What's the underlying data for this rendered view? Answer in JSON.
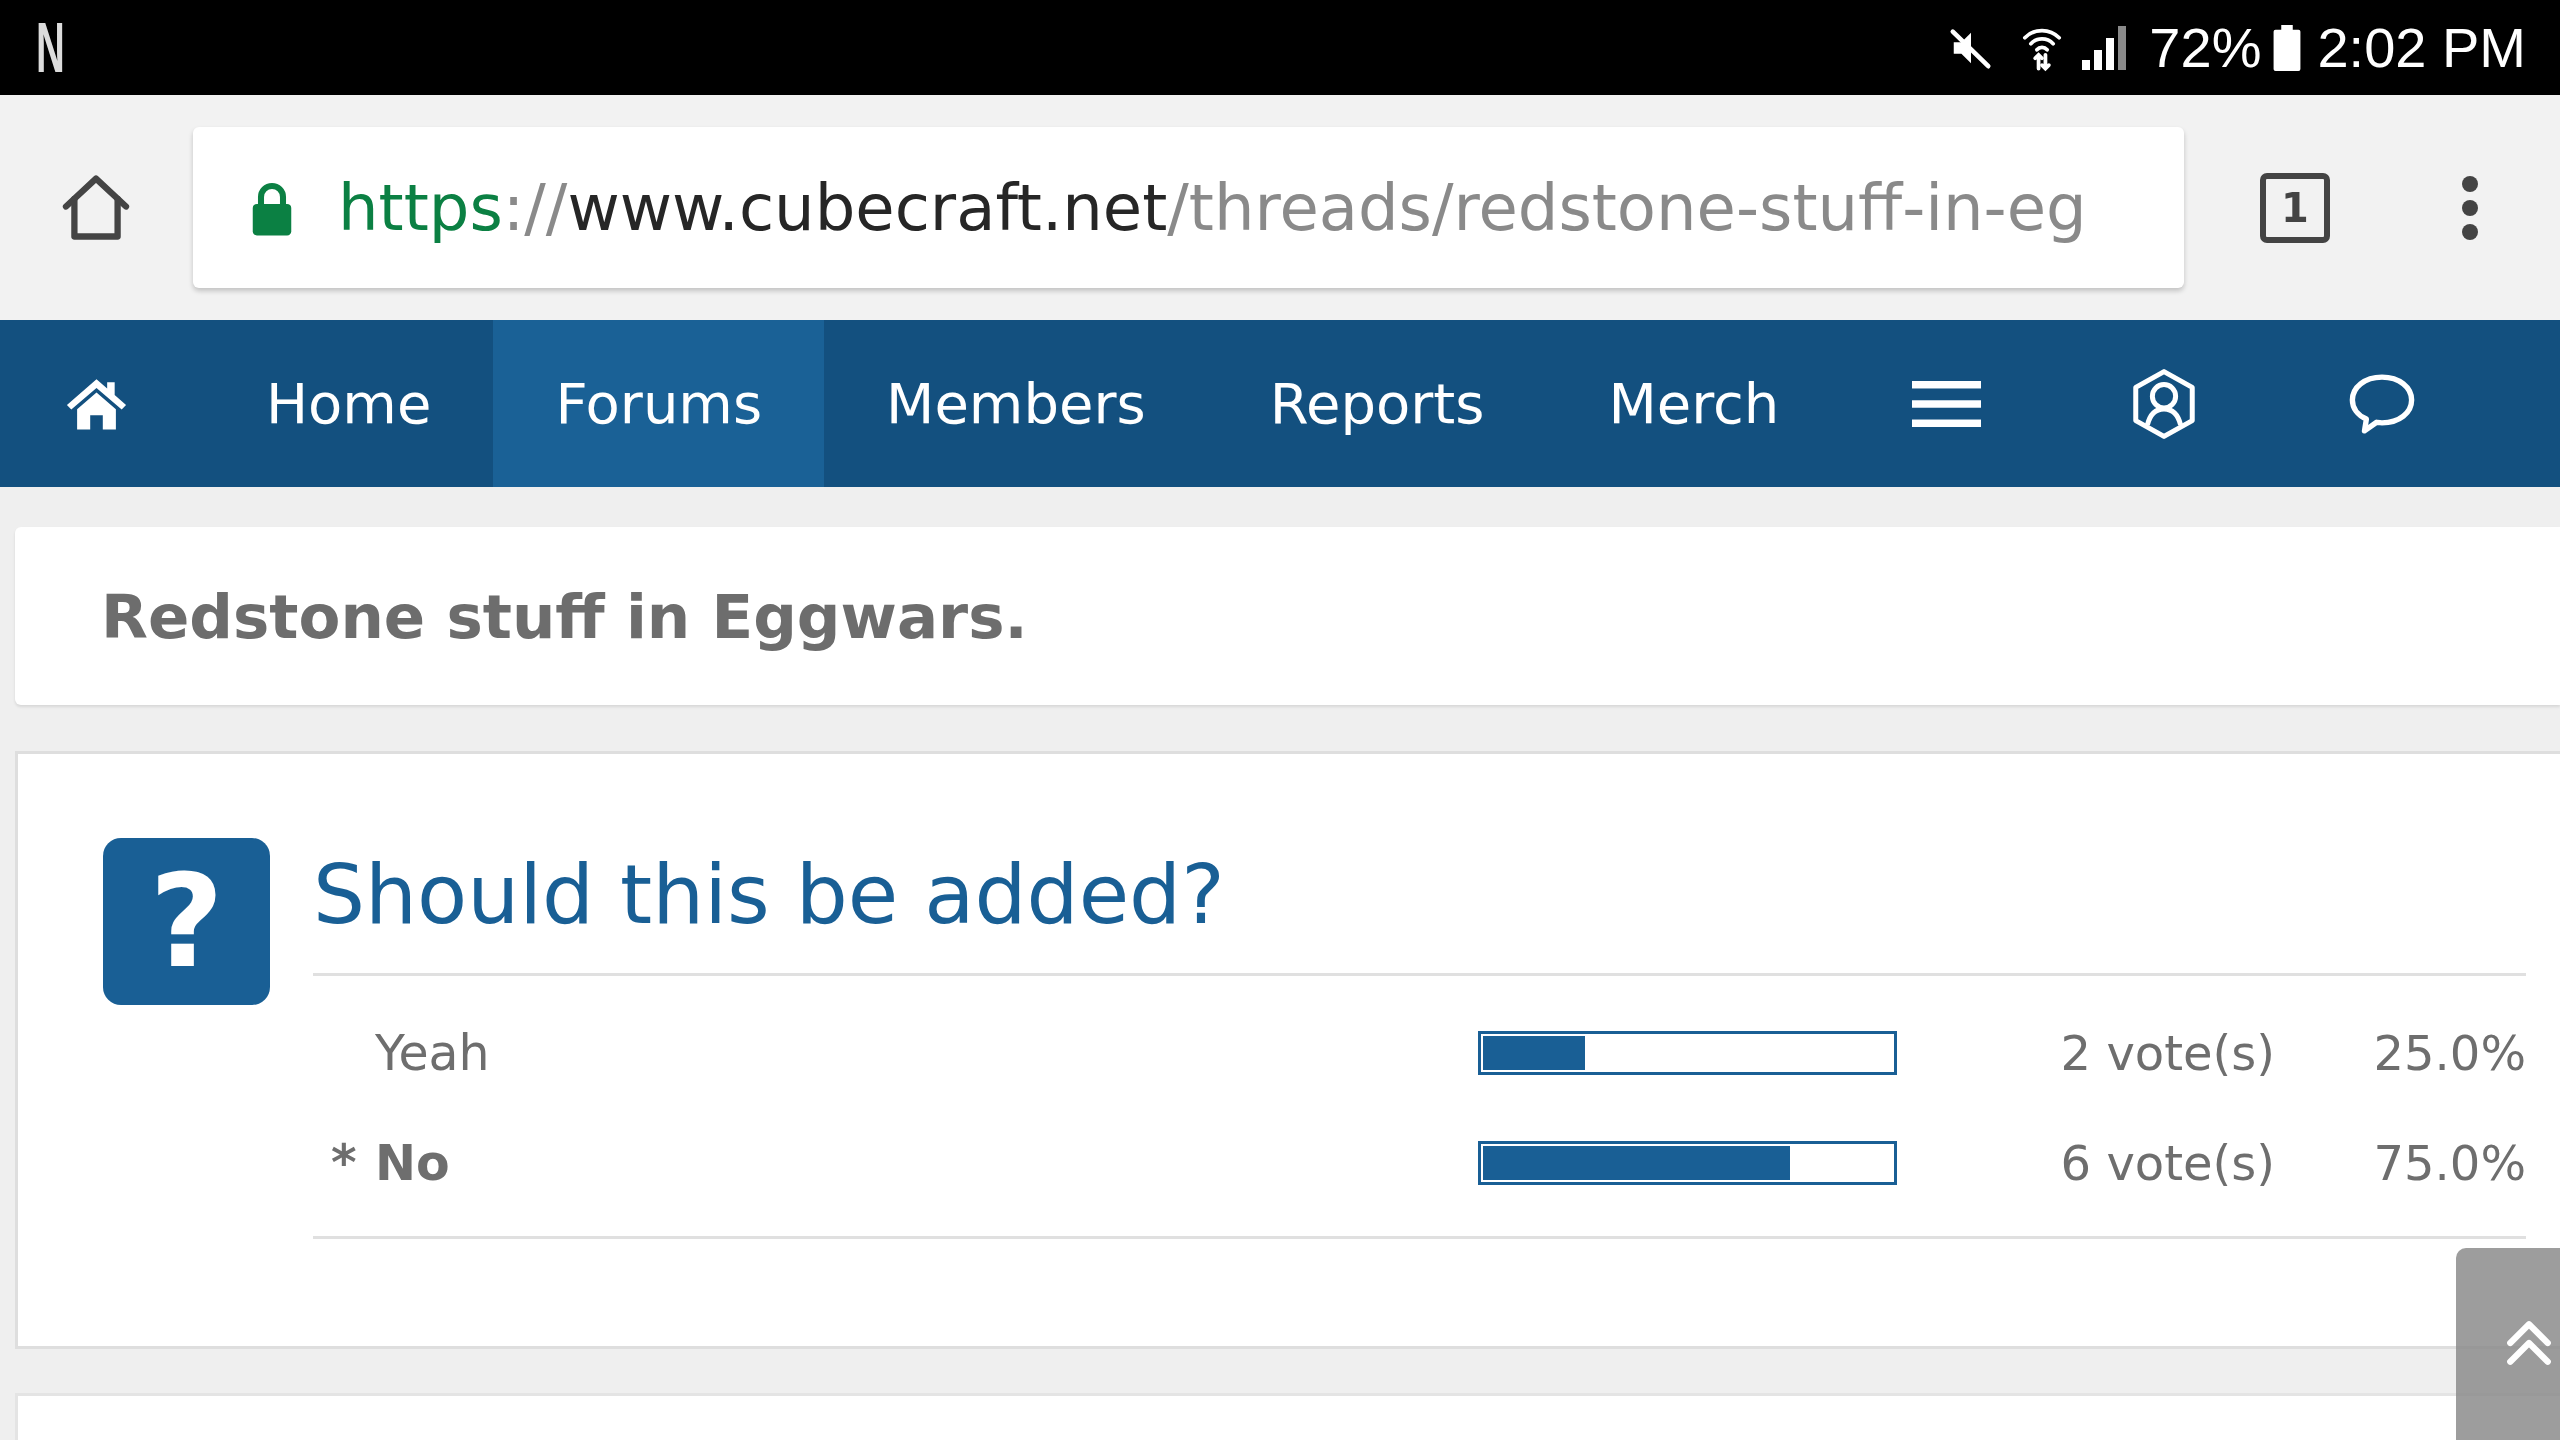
{
  "status_bar": {
    "notification": "N",
    "battery": "72%",
    "time": "2:02 PM"
  },
  "browser": {
    "url": [
      {
        "kind": "scheme",
        "text": "https"
      },
      {
        "kind": "punct",
        "text": "://"
      },
      {
        "kind": "host",
        "text": "www.cubecraft.net"
      },
      {
        "kind": "path",
        "text": "/threads/redstone-stuff-in-eg"
      }
    ],
    "tab_count": "1"
  },
  "nav": {
    "items": [
      {
        "label": "Home",
        "selected": false
      },
      {
        "label": "Forums",
        "selected": true
      },
      {
        "label": "Members",
        "selected": false
      },
      {
        "label": "Reports",
        "selected": false
      },
      {
        "label": "Merch",
        "selected": false
      }
    ]
  },
  "thread": {
    "title": "Redstone stuff in Eggwars."
  },
  "poll": {
    "icon": "?",
    "question": "Should this be added?",
    "options": [
      {
        "label": "Yeah",
        "voted": false,
        "level": 0.25,
        "votes": "2 vote(s)",
        "percent": "25.0%"
      },
      {
        "label": "No",
        "voted": true,
        "marker": "*",
        "level": 0.75,
        "votes": "6 vote(s)",
        "percent": "75.0%"
      }
    ]
  }
}
